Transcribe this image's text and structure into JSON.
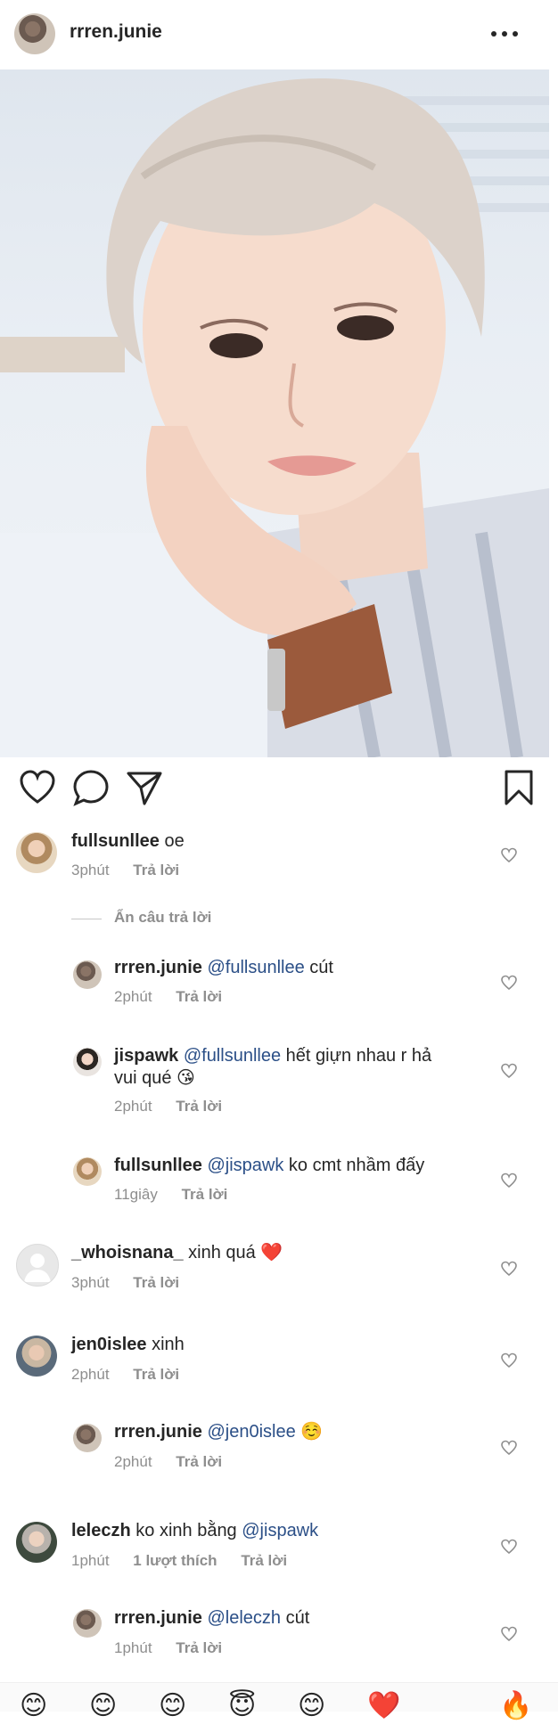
{
  "post": {
    "author": "rrren.junie"
  },
  "comments": [
    {
      "user": "fullsunllee",
      "mention": "",
      "text": "oe",
      "time": "3phút",
      "likes": "",
      "reply": "Trả lời"
    },
    {
      "user": "rrren.junie",
      "mention": "@fullsunllee",
      "text": "cút",
      "time": "2phút",
      "likes": "",
      "reply": "Trả lời"
    },
    {
      "user": "jispawk",
      "mention": "@fullsunllee",
      "text": "hết giựn nhau r hả",
      "text2": "vui qué 😘",
      "time": "2phút",
      "likes": "",
      "reply": "Trả lời"
    },
    {
      "user": "fullsunllee",
      "mention": "@jispawk",
      "text": "ko cmt nhầm đấy",
      "time": "11giây",
      "likes": "",
      "reply": "Trả lời"
    },
    {
      "user": "_whoisnana_",
      "mention": "",
      "text": "xinh quá ❤️",
      "time": "3phút",
      "likes": "",
      "reply": "Trả lời"
    },
    {
      "user": "jen0islee",
      "mention": "",
      "text": "xinh",
      "time": "2phút",
      "likes": "",
      "reply": "Trả lời"
    },
    {
      "user": "rrren.junie",
      "mention": "@jen0islee",
      "text": "☺️",
      "time": "2phút",
      "likes": "",
      "reply": "Trả lời"
    },
    {
      "user": "leleczh",
      "mention": "@jispawk",
      "text_before": "ko xinh bằng",
      "time": "1phút",
      "likes": "1 lượt thích",
      "reply": "Trả lời"
    },
    {
      "user": "rrren.junie",
      "mention": "@leleczh",
      "text": "cút",
      "time": "1phút",
      "likes": "",
      "reply": "Trả lời"
    }
  ],
  "hide_replies_label": "Ẩn câu trả lời",
  "emoji_bar": [
    "😊",
    "😊",
    "😊",
    "😇",
    "😊",
    "❤️",
    "🔥"
  ]
}
